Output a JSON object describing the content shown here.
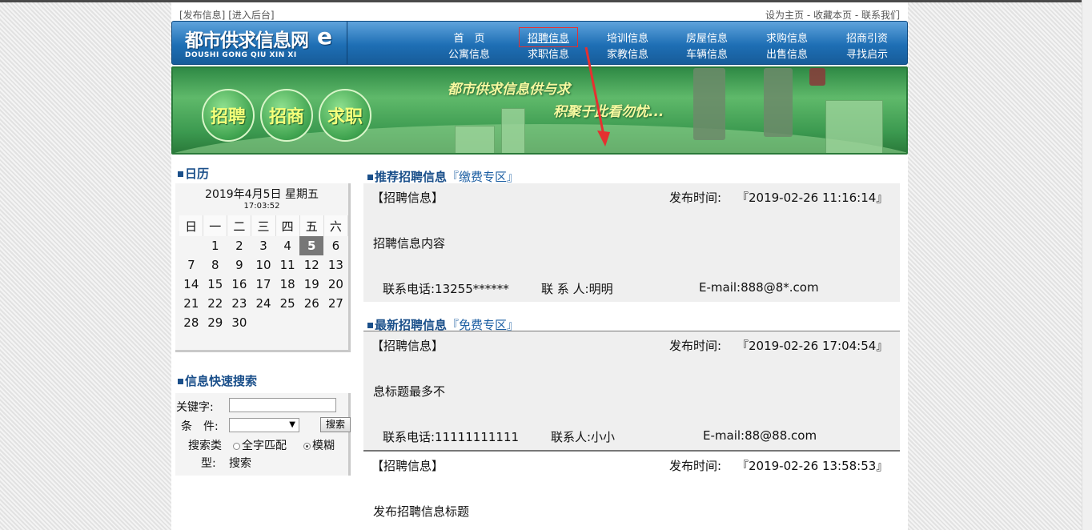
{
  "header": {
    "left_links": [
      "[发布信息]",
      "[进入后台]"
    ],
    "right_links": [
      "设为主页",
      "收藏本页",
      "联系我们"
    ],
    "separator": " - "
  },
  "logo": {
    "main": "都市供求信息网",
    "e": "e",
    "sub": "DOUSHI  GONG QIU XIN XI"
  },
  "nav": {
    "row1": [
      "首　页",
      "招聘信息",
      "培训信息",
      "房屋信息",
      "求购信息",
      "招商引资"
    ],
    "row2": [
      "公寓信息",
      "求职信息",
      "家教信息",
      "车辆信息",
      "出售信息",
      "寻找启示"
    ],
    "active": "招聘信息"
  },
  "banner": {
    "buttons": [
      "招聘",
      "招商",
      "求职"
    ],
    "slogan1": "都市供求信息供与求",
    "slogan2": "积聚于此看勿忧..."
  },
  "calendar": {
    "title": "日历",
    "date": "2019年4月5日 星期五",
    "time": "17:03:52",
    "weekdays": [
      "日",
      "一",
      "二",
      "三",
      "四",
      "五",
      "六"
    ],
    "weeks": [
      [
        "",
        "1",
        "2",
        "3",
        "4",
        "5",
        "6"
      ],
      [
        "7",
        "8",
        "9",
        "10",
        "11",
        "12",
        "13"
      ],
      [
        "14",
        "15",
        "16",
        "17",
        "18",
        "19",
        "20"
      ],
      [
        "21",
        "22",
        "23",
        "24",
        "25",
        "26",
        "27"
      ],
      [
        "28",
        "29",
        "30",
        "",
        "",
        "",
        ""
      ]
    ],
    "today": "5"
  },
  "search": {
    "title": "信息快速搜索",
    "keyword_label": "关键字:",
    "keyword_value": "",
    "condition_label": "条　件:",
    "condition_value": "▼",
    "button": "搜索",
    "type_label": "搜索类",
    "type_label2": "型:",
    "options": [
      "全字匹配",
      "模糊",
      "搜索"
    ],
    "selected": "模糊"
  },
  "recommended": {
    "title": "推荐招聘信息",
    "tag": "『缴费专区』",
    "items": [
      {
        "tag": "【招聘信息】",
        "time_label": "发布时间:",
        "time": "『2019-02-26 11:16:14』",
        "title": "招聘信息内容",
        "phone": "联系电话:13255******",
        "contact": "联 系 人:明明",
        "email": "E-mail:888@8*.com"
      }
    ]
  },
  "latest": {
    "title": "最新招聘信息",
    "tag": "『免费专区』",
    "items": [
      {
        "tag": "【招聘信息】",
        "time_label": "发布时间:",
        "time": "『2019-02-26 17:04:54』",
        "title": "息标题最多不",
        "phone": "联系电话:11111111111",
        "contact": "联系人:小小",
        "email": "E-mail:88@88.com"
      },
      {
        "tag": "【招聘信息】",
        "time_label": "发布时间:",
        "time": "『2019-02-26 13:58:53』",
        "title": "发布招聘信息标题"
      }
    ]
  }
}
